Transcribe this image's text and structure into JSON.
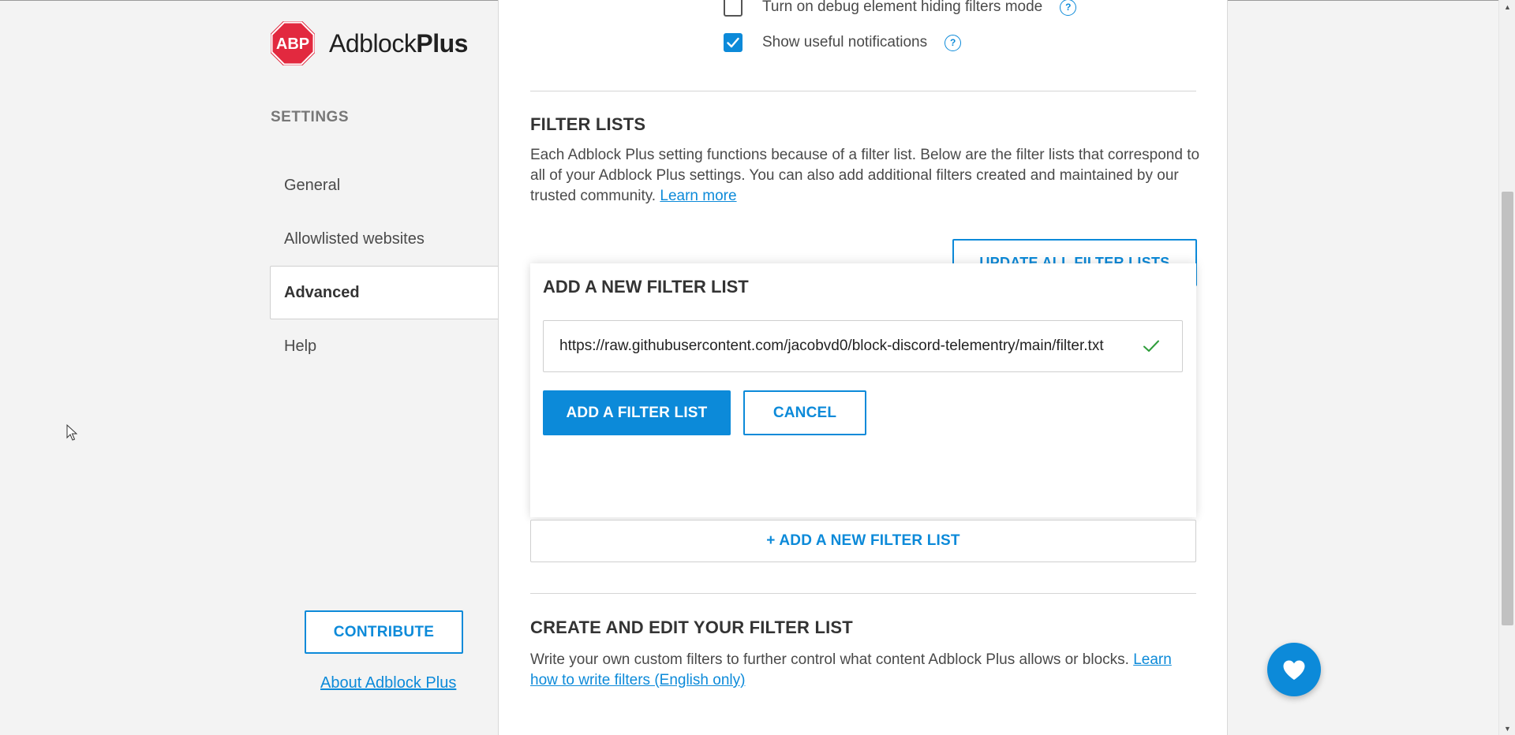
{
  "brand": {
    "name_light": "Adblock",
    "name_bold": "Plus",
    "logo_text": "ABP",
    "logo_color": "#e2293f"
  },
  "sidebar": {
    "heading": "SETTINGS",
    "items": [
      {
        "label": "General",
        "active": false
      },
      {
        "label": "Allowlisted websites",
        "active": false
      },
      {
        "label": "Advanced",
        "active": true
      },
      {
        "label": "Help",
        "active": false
      }
    ],
    "contribute_label": "CONTRIBUTE",
    "about_label": "About Adblock Plus"
  },
  "options": {
    "debug_label": "Turn on debug element hiding filters mode",
    "debug_checked": false,
    "notifications_label": "Show useful notifications",
    "notifications_checked": true,
    "help_glyph": "?"
  },
  "filter_lists": {
    "title": "FILTER LISTS",
    "description": "Each Adblock Plus setting functions because of a filter list. Below are the filter lists that correspond to all of your Adblock Plus settings. You can also add additional filters created and maintained by our trusted community.",
    "learn_more": "Learn more",
    "update_all_label": "UPDATE ALL FILTER LISTS"
  },
  "add_panel": {
    "title": "ADD A NEW FILTER LIST",
    "url_value": "https://raw.githubusercontent.com/jacobvd0/block-discord-telementry/main/filter.txt",
    "url_valid": true,
    "add_label": "ADD A FILTER LIST",
    "cancel_label": "CANCEL"
  },
  "add_new_label": "+ ADD A NEW FILTER LIST",
  "custom": {
    "title": "CREATE AND EDIT YOUR FILTER LIST",
    "description": "Write your own custom filters to further control what content Adblock Plus allows or blocks.",
    "learn_link": "Learn how to write filters (English only)"
  },
  "colors": {
    "accent": "#0c8ad9",
    "valid": "#2e9d3a"
  },
  "icons": {
    "fab": "heart-icon",
    "check": "checkmark-icon"
  }
}
